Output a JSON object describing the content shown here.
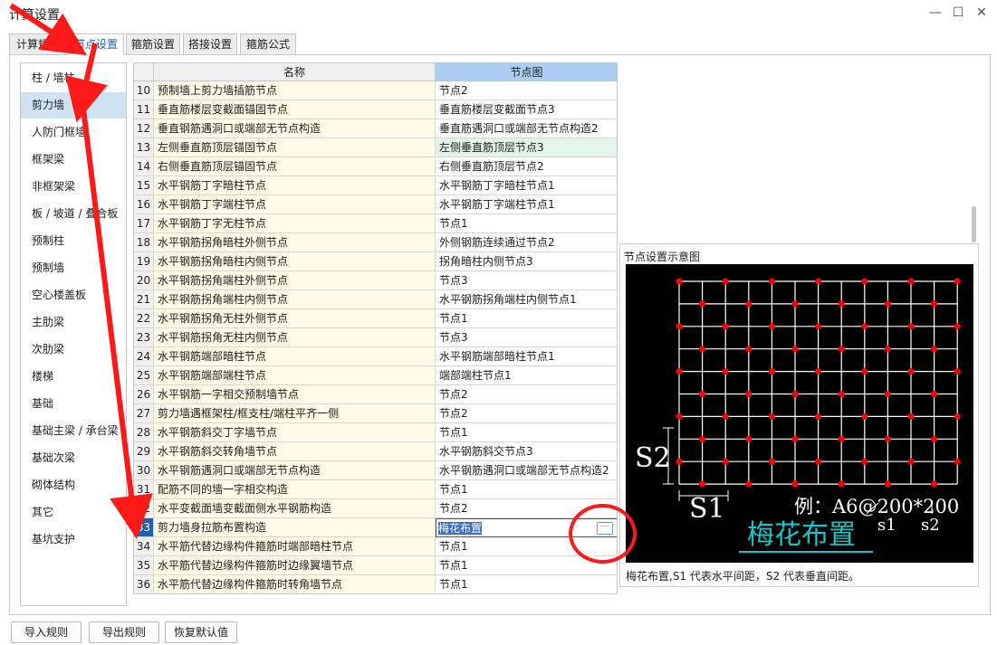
{
  "window": {
    "title": "计算设置",
    "minimize_icon": "—",
    "maximize_icon": "☐",
    "close_icon": "✕"
  },
  "tabs": [
    {
      "label": "计算规则"
    },
    {
      "label": "节点设置"
    },
    {
      "label": "箍筋设置"
    },
    {
      "label": "搭接设置"
    },
    {
      "label": "箍筋公式"
    }
  ],
  "sidebar": {
    "items": [
      "柱 / 墙柱",
      "剪力墙",
      "人防门框墙",
      "框架梁",
      "非框架梁",
      "板 / 坡道 / 叠合板",
      "预制柱",
      "预制墙",
      "空心楼盖板",
      "主肋梁",
      "次肋梁",
      "楼梯",
      "基础",
      "基础主梁 / 承台梁",
      "基础次梁",
      "砌体结构",
      "其它",
      "基坑支护"
    ],
    "selected": "剪力墙"
  },
  "table": {
    "columns": [
      "",
      "名称",
      "节点图"
    ],
    "rows": [
      [
        "10",
        "预制墙上剪力墙插筋节点",
        "节点2"
      ],
      [
        "11",
        "垂直筋楼层变截面锚固节点",
        "垂直筋楼层变截面节点3"
      ],
      [
        "12",
        "垂直钢筋遇洞口或端部无节点构造",
        "垂直筋遇洞口或端部无节点构造2"
      ],
      [
        "13",
        "左侧垂直筋顶层锚固节点",
        "左侧垂直筋顶层节点3"
      ],
      [
        "14",
        "右侧垂直筋顶层锚固节点",
        "右侧垂直筋顶层节点2"
      ],
      [
        "15",
        "水平钢筋丁字暗柱节点",
        "水平钢筋丁字暗柱节点1"
      ],
      [
        "16",
        "水平钢筋丁字端柱节点",
        "水平钢筋丁字端柱节点1"
      ],
      [
        "17",
        "水平钢筋丁字无柱节点",
        "节点1"
      ],
      [
        "18",
        "水平钢筋拐角暗柱外侧节点",
        "外侧钢筋连续通过节点2"
      ],
      [
        "19",
        "水平钢筋拐角暗柱内侧节点",
        "拐角暗柱内侧节点3"
      ],
      [
        "20",
        "水平钢筋拐角端柱外侧节点",
        "节点3"
      ],
      [
        "21",
        "水平钢筋拐角端柱内侧节点",
        "水平钢筋拐角端柱内侧节点1"
      ],
      [
        "22",
        "水平钢筋拐角无柱外侧节点",
        "节点1"
      ],
      [
        "23",
        "水平钢筋拐角无柱内侧节点",
        "节点3"
      ],
      [
        "24",
        "水平钢筋端部暗柱节点",
        "水平钢筋端部暗柱节点1"
      ],
      [
        "25",
        "水平钢筋端部端柱节点",
        "端部端柱节点1"
      ],
      [
        "26",
        "水平钢筋一字相交预制墙节点",
        "节点2"
      ],
      [
        "27",
        "剪力墙遇框架柱/框支柱/端柱平齐一侧",
        "节点2"
      ],
      [
        "28",
        "水平钢筋斜交丁字墙节点",
        "节点1"
      ],
      [
        "29",
        "水平钢筋斜交转角墙节点",
        "水平钢筋斜交节点3"
      ],
      [
        "30",
        "水平钢筋遇洞口或端部无节点构造",
        "水平钢筋遇洞口或端部无节点构造2"
      ],
      [
        "31",
        "配筋不同的墙一字相交构造",
        "节点1"
      ],
      [
        "32",
        "水平变截面墙变截面侧水平钢筋构造",
        "节点2"
      ],
      [
        "33",
        "剪力墙身拉筋布置构造",
        "梅花布置"
      ],
      [
        "34",
        "水平筋代替边缘构件箍筋时端部暗柱节点",
        "节点1"
      ],
      [
        "35",
        "水平筋代替边缘构件箍筋时边缘翼墙节点",
        "节点1"
      ],
      [
        "36",
        "水平筋代替边缘构件箍筋时转角墙节点",
        "节点1"
      ]
    ],
    "highlighted_row": "13",
    "editing_row": "33",
    "ellipsis_button": "···"
  },
  "preview": {
    "title": "节点设置示意图",
    "diagram": {
      "label_s2": "S2",
      "label_s1": "S1",
      "example": "例：A6@200*200",
      "example_s1": "s1",
      "example_s2": "s2",
      "caption": "梅花布置"
    },
    "note": "梅花布置,S1 代表水平间距，S2 代表垂直间距。"
  },
  "buttons": {
    "import": "导入规则",
    "export": "导出规则",
    "restore": "恢复默认值"
  },
  "colors": {
    "accent": "#1f5fb0",
    "annotation": "#ff1a1a",
    "row_highlight": "#e2f4e8",
    "dot": "#ff0000",
    "diagram_caption": "#19c4c4"
  }
}
